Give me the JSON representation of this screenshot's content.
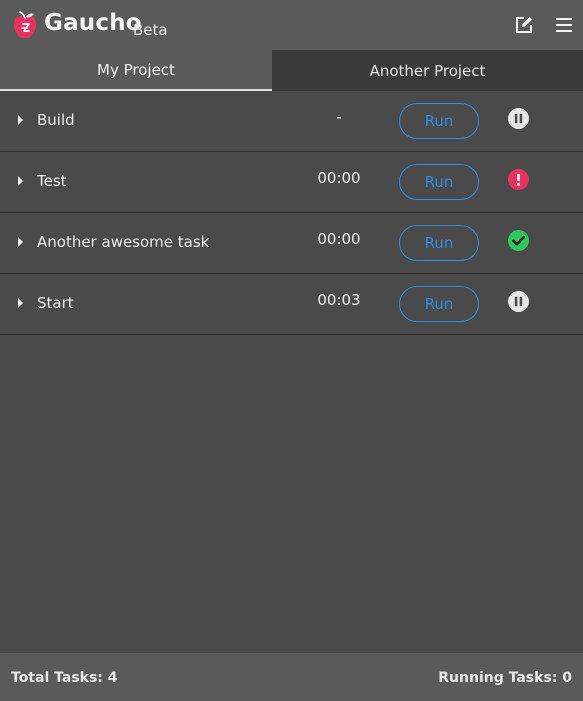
{
  "header": {
    "title": "Gaucho",
    "badge": "Beta",
    "logo_icon": "apple-logo-icon",
    "edit_icon": "edit-icon",
    "menu_icon": "hamburger-menu-icon"
  },
  "tabs": [
    {
      "label": "My Project",
      "active": true
    },
    {
      "label": "Another Project",
      "active": false
    }
  ],
  "tasks": [
    {
      "name": "Build",
      "time": "-",
      "run_label": "Run",
      "status": "paused",
      "status_icon": "pause-icon"
    },
    {
      "name": "Test",
      "time": "00:00",
      "run_label": "Run",
      "status": "error",
      "status_icon": "error-icon"
    },
    {
      "name": "Another awesome task",
      "time": "00:00",
      "run_label": "Run",
      "status": "success",
      "status_icon": "check-icon"
    },
    {
      "name": "Start",
      "time": "00:03",
      "run_label": "Run",
      "status": "paused",
      "status_icon": "pause-icon"
    }
  ],
  "footer": {
    "total_label": "Total Tasks: 4",
    "running_label": "Running Tasks: 0"
  },
  "colors": {
    "accent": "#2b8fe8",
    "error": "#e8315f",
    "success": "#2ec95c",
    "paused": "#e6e6e6",
    "logo": "#e8315f"
  }
}
